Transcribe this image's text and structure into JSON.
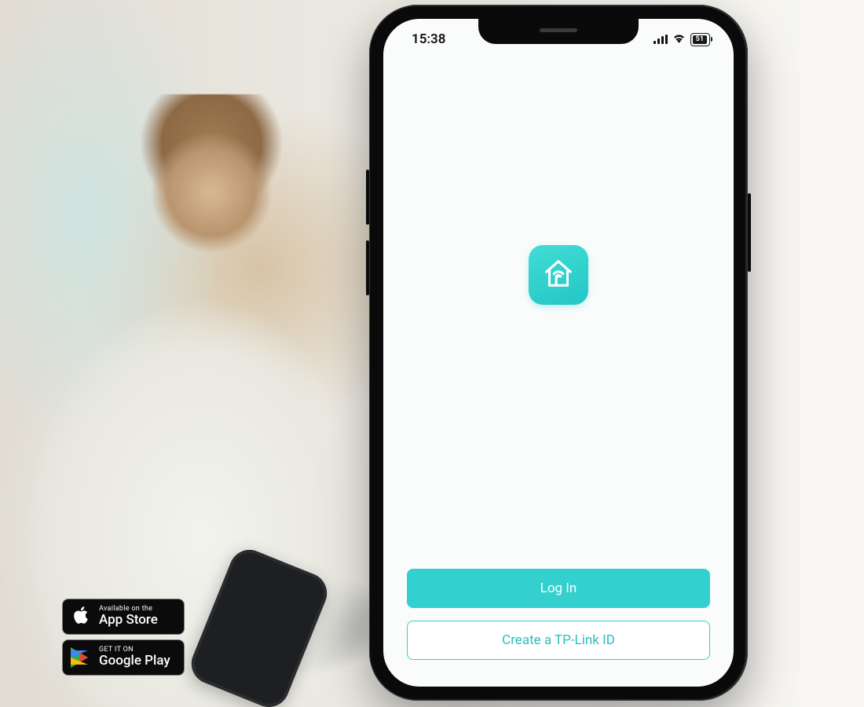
{
  "colors": {
    "accent": "#34cfcf",
    "accent_text": "#28bfbf",
    "screen_bg": "#fafbfb"
  },
  "status_bar": {
    "time": "15:38",
    "battery_percent": "51",
    "signal_icon": "signal-4-bars-icon",
    "wifi_icon": "wifi-icon"
  },
  "app": {
    "logo_icon": "tether-house-wifi-icon"
  },
  "buttons": {
    "login_label": "Log In",
    "create_label": "Create a TP-Link ID"
  },
  "store_badges": {
    "apple": {
      "line1": "Available on the",
      "line2": "App Store",
      "icon": "apple-icon"
    },
    "google": {
      "line1": "GET IT ON",
      "line2": "Google Play",
      "icon": "google-play-icon"
    }
  }
}
